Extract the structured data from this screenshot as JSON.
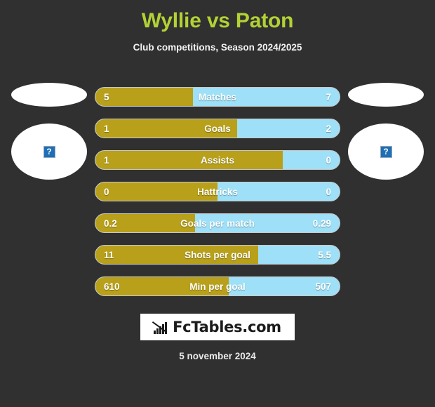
{
  "header": {
    "title": "Wyllie vs Paton",
    "subtitle": "Club competitions, Season 2024/2025",
    "title_color": "#b2d235"
  },
  "players": {
    "home": {
      "photo_alt": "?"
    },
    "away": {
      "photo_alt": "?"
    }
  },
  "colors": {
    "background": "#303030",
    "home_bar": "#b8a01a",
    "away_bar": "#9ee0f7",
    "accent": "#b2d235"
  },
  "footer": {
    "logo_text": "FcTables.com",
    "date": "5 november 2024"
  },
  "chart_data": {
    "type": "bar",
    "title": "Wyllie vs Paton",
    "subtitle": "Club competitions, Season 2024/2025",
    "orientation": "horizontal-diverging",
    "legend": [
      "Wyllie",
      "Paton"
    ],
    "categories": [
      "Matches",
      "Goals",
      "Assists",
      "Hattricks",
      "Goals per match",
      "Shots per goal",
      "Min per goal"
    ],
    "series": [
      {
        "name": "Wyllie",
        "color": "#b8a01a",
        "values": [
          5,
          1,
          1,
          0,
          0.2,
          11,
          610
        ]
      },
      {
        "name": "Paton",
        "color": "#9ee0f7",
        "values": [
          7,
          2,
          0,
          0,
          0.29,
          5.5,
          507
        ]
      }
    ],
    "rows": [
      {
        "label": "Matches",
        "home": "5",
        "away": "7",
        "home_pct": 40.0
      },
      {
        "label": "Goals",
        "home": "1",
        "away": "2",
        "home_pct": 58.0
      },
      {
        "label": "Assists",
        "home": "1",
        "away": "0",
        "home_pct": 76.6
      },
      {
        "label": "Hattricks",
        "home": "0",
        "away": "0",
        "home_pct": 50.0
      },
      {
        "label": "Goals per match",
        "home": "0.2",
        "away": "0.29",
        "home_pct": 40.8
      },
      {
        "label": "Shots per goal",
        "home": "11",
        "away": "5.5",
        "home_pct": 66.7
      },
      {
        "label": "Min per goal",
        "home": "610",
        "away": "507",
        "home_pct": 54.6
      }
    ]
  }
}
